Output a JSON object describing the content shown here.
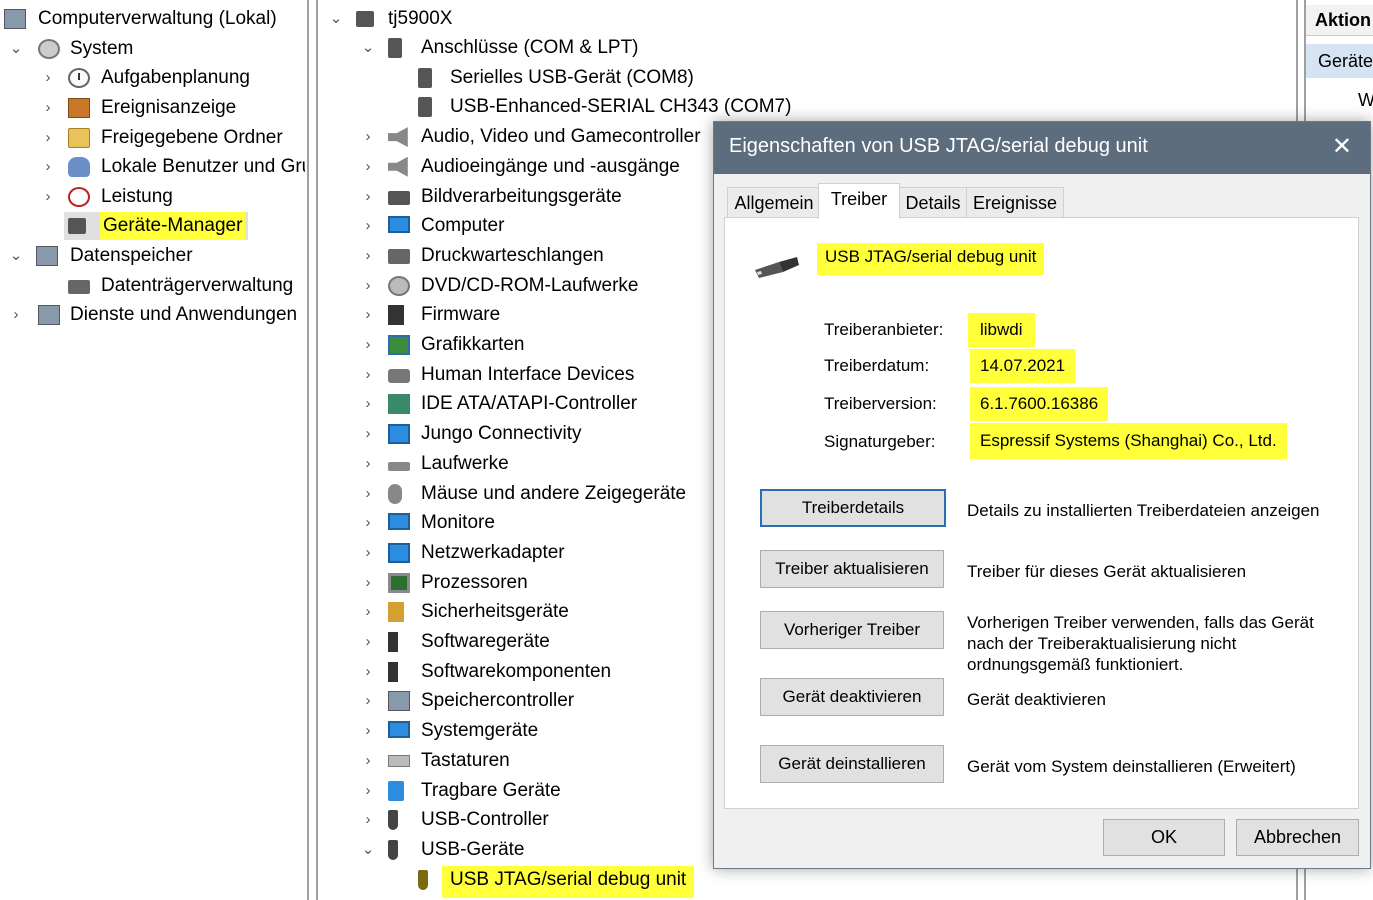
{
  "left_tree": {
    "items": [
      {
        "label": "Computerverwaltung (Lokal)",
        "icon": "computer-management-icon"
      },
      {
        "label": "System",
        "icon": "tools-icon"
      },
      {
        "label": "Aufgabenplanung",
        "icon": "clock-icon"
      },
      {
        "label": "Ereignisanzeige",
        "icon": "event-viewer-icon"
      },
      {
        "label": "Freigegebene Ordner",
        "icon": "shared-folder-icon"
      },
      {
        "label": "Lokale Benutzer und Gru",
        "icon": "users-icon"
      },
      {
        "label": "Leistung",
        "icon": "performance-icon"
      },
      {
        "label": "Geräte-Manager",
        "icon": "device-manager-icon"
      },
      {
        "label": "Datenspeicher",
        "icon": "storage-icon"
      },
      {
        "label": "Datenträgerverwaltung",
        "icon": "disk-management-icon"
      },
      {
        "label": "Dienste und Anwendungen",
        "icon": "services-icon"
      }
    ]
  },
  "device_tree": {
    "root": "tj5900X",
    "items": [
      {
        "label": "Anschlüsse (COM & LPT)",
        "icon": "port-icon"
      },
      {
        "label": "Serielles USB-Gerät (COM8)",
        "icon": "port-icon"
      },
      {
        "label": "USB-Enhanced-SERIAL CH343 (COM7)",
        "icon": "port-icon"
      },
      {
        "label": "Audio, Video und Gamecontroller",
        "icon": "speaker-icon"
      },
      {
        "label": "Audioeingänge und -ausgänge",
        "icon": "speaker-icon"
      },
      {
        "label": "Bildverarbeitungsgeräte",
        "icon": "camera-icon"
      },
      {
        "label": "Computer",
        "icon": "monitor-icon"
      },
      {
        "label": "Druckwarteschlangen",
        "icon": "printer-icon"
      },
      {
        "label": "DVD/CD-ROM-Laufwerke",
        "icon": "dvd-icon"
      },
      {
        "label": "Firmware",
        "icon": "chip-icon"
      },
      {
        "label": "Grafikkarten",
        "icon": "graphics-card-icon"
      },
      {
        "label": "Human Interface Devices",
        "icon": "hid-icon"
      },
      {
        "label": "IDE ATA/ATAPI-Controller",
        "icon": "ide-icon"
      },
      {
        "label": "Jungo Connectivity",
        "icon": "network-icon"
      },
      {
        "label": "Laufwerke",
        "icon": "drive-icon"
      },
      {
        "label": "Mäuse und andere Zeigegeräte",
        "icon": "mouse-icon"
      },
      {
        "label": "Monitore",
        "icon": "monitor-icon"
      },
      {
        "label": "Netzwerkadapter",
        "icon": "network-icon"
      },
      {
        "label": "Prozessoren",
        "icon": "cpu-icon"
      },
      {
        "label": "Sicherheitsgeräte",
        "icon": "security-icon"
      },
      {
        "label": "Softwaregeräte",
        "icon": "software-device-icon"
      },
      {
        "label": "Softwarekomponenten",
        "icon": "software-component-icon"
      },
      {
        "label": "Speichercontroller",
        "icon": "storage-controller-icon"
      },
      {
        "label": "Systemgeräte",
        "icon": "system-device-icon"
      },
      {
        "label": "Tastaturen",
        "icon": "keyboard-icon"
      },
      {
        "label": "Tragbare Geräte",
        "icon": "portable-device-icon"
      },
      {
        "label": "USB-Controller",
        "icon": "usb-icon"
      },
      {
        "label": "USB-Geräte",
        "icon": "usb-icon"
      },
      {
        "label": "USB JTAG/serial debug unit",
        "icon": "usb-device-icon"
      }
    ]
  },
  "right_pane": {
    "header": "Aktion",
    "selected": "Geräte",
    "sub": "W"
  },
  "dialog": {
    "title": "Eigenschaften von USB JTAG/serial debug unit",
    "tabs": [
      "Allgemein",
      "Treiber",
      "Details",
      "Ereignisse"
    ],
    "device_name": "USB JTAG/serial debug unit",
    "fields": [
      {
        "label": "Treiberanbieter:",
        "value": "libwdi"
      },
      {
        "label": "Treiberdatum:",
        "value": "14.07.2021"
      },
      {
        "label": "Treiberversion:",
        "value": "6.1.7600.16386"
      },
      {
        "label": "Signaturgeber:",
        "value": "Espressif Systems (Shanghai) Co., Ltd."
      }
    ],
    "actions": [
      {
        "button": "Treiberdetails",
        "desc": "Details zu installierten Treiberdateien anzeigen"
      },
      {
        "button": "Treiber aktualisieren",
        "desc": "Treiber für dieses Gerät aktualisieren"
      },
      {
        "button": "Vorheriger Treiber",
        "desc": "Vorherigen Treiber verwenden, falls das Gerät nach der Treiberaktualisierung nicht ordnungsgemäß funktioniert."
      },
      {
        "button": "Gerät deaktivieren",
        "desc": "Gerät deaktivieren"
      },
      {
        "button": "Gerät deinstallieren",
        "desc": "Gerät vom System deinstallieren (Erweitert)"
      }
    ],
    "ok": "OK",
    "cancel": "Abbrechen"
  },
  "colors": {
    "highlight": "#ffff3a",
    "titlebar": "#5d6d7e",
    "selected_bg": "#d5e3f2"
  }
}
